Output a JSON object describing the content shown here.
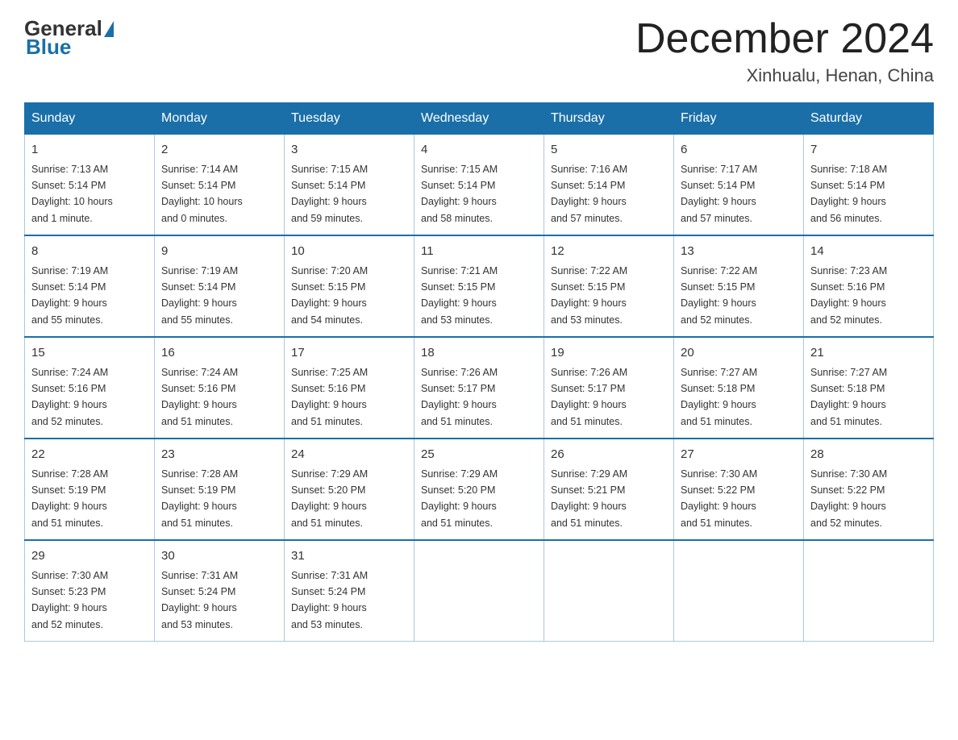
{
  "logo": {
    "general": "General",
    "blue": "Blue"
  },
  "title": "December 2024",
  "subtitle": "Xinhualu, Henan, China",
  "weekdays": [
    "Sunday",
    "Monday",
    "Tuesday",
    "Wednesday",
    "Thursday",
    "Friday",
    "Saturday"
  ],
  "weeks": [
    [
      {
        "day": "1",
        "sunrise": "7:13 AM",
        "sunset": "5:14 PM",
        "daylight": "10 hours and 1 minute."
      },
      {
        "day": "2",
        "sunrise": "7:14 AM",
        "sunset": "5:14 PM",
        "daylight": "10 hours and 0 minutes."
      },
      {
        "day": "3",
        "sunrise": "7:15 AM",
        "sunset": "5:14 PM",
        "daylight": "9 hours and 59 minutes."
      },
      {
        "day": "4",
        "sunrise": "7:15 AM",
        "sunset": "5:14 PM",
        "daylight": "9 hours and 58 minutes."
      },
      {
        "day": "5",
        "sunrise": "7:16 AM",
        "sunset": "5:14 PM",
        "daylight": "9 hours and 57 minutes."
      },
      {
        "day": "6",
        "sunrise": "7:17 AM",
        "sunset": "5:14 PM",
        "daylight": "9 hours and 57 minutes."
      },
      {
        "day": "7",
        "sunrise": "7:18 AM",
        "sunset": "5:14 PM",
        "daylight": "9 hours and 56 minutes."
      }
    ],
    [
      {
        "day": "8",
        "sunrise": "7:19 AM",
        "sunset": "5:14 PM",
        "daylight": "9 hours and 55 minutes."
      },
      {
        "day": "9",
        "sunrise": "7:19 AM",
        "sunset": "5:14 PM",
        "daylight": "9 hours and 55 minutes."
      },
      {
        "day": "10",
        "sunrise": "7:20 AM",
        "sunset": "5:15 PM",
        "daylight": "9 hours and 54 minutes."
      },
      {
        "day": "11",
        "sunrise": "7:21 AM",
        "sunset": "5:15 PM",
        "daylight": "9 hours and 53 minutes."
      },
      {
        "day": "12",
        "sunrise": "7:22 AM",
        "sunset": "5:15 PM",
        "daylight": "9 hours and 53 minutes."
      },
      {
        "day": "13",
        "sunrise": "7:22 AM",
        "sunset": "5:15 PM",
        "daylight": "9 hours and 52 minutes."
      },
      {
        "day": "14",
        "sunrise": "7:23 AM",
        "sunset": "5:16 PM",
        "daylight": "9 hours and 52 minutes."
      }
    ],
    [
      {
        "day": "15",
        "sunrise": "7:24 AM",
        "sunset": "5:16 PM",
        "daylight": "9 hours and 52 minutes."
      },
      {
        "day": "16",
        "sunrise": "7:24 AM",
        "sunset": "5:16 PM",
        "daylight": "9 hours and 51 minutes."
      },
      {
        "day": "17",
        "sunrise": "7:25 AM",
        "sunset": "5:16 PM",
        "daylight": "9 hours and 51 minutes."
      },
      {
        "day": "18",
        "sunrise": "7:26 AM",
        "sunset": "5:17 PM",
        "daylight": "9 hours and 51 minutes."
      },
      {
        "day": "19",
        "sunrise": "7:26 AM",
        "sunset": "5:17 PM",
        "daylight": "9 hours and 51 minutes."
      },
      {
        "day": "20",
        "sunrise": "7:27 AM",
        "sunset": "5:18 PM",
        "daylight": "9 hours and 51 minutes."
      },
      {
        "day": "21",
        "sunrise": "7:27 AM",
        "sunset": "5:18 PM",
        "daylight": "9 hours and 51 minutes."
      }
    ],
    [
      {
        "day": "22",
        "sunrise": "7:28 AM",
        "sunset": "5:19 PM",
        "daylight": "9 hours and 51 minutes."
      },
      {
        "day": "23",
        "sunrise": "7:28 AM",
        "sunset": "5:19 PM",
        "daylight": "9 hours and 51 minutes."
      },
      {
        "day": "24",
        "sunrise": "7:29 AM",
        "sunset": "5:20 PM",
        "daylight": "9 hours and 51 minutes."
      },
      {
        "day": "25",
        "sunrise": "7:29 AM",
        "sunset": "5:20 PM",
        "daylight": "9 hours and 51 minutes."
      },
      {
        "day": "26",
        "sunrise": "7:29 AM",
        "sunset": "5:21 PM",
        "daylight": "9 hours and 51 minutes."
      },
      {
        "day": "27",
        "sunrise": "7:30 AM",
        "sunset": "5:22 PM",
        "daylight": "9 hours and 51 minutes."
      },
      {
        "day": "28",
        "sunrise": "7:30 AM",
        "sunset": "5:22 PM",
        "daylight": "9 hours and 52 minutes."
      }
    ],
    [
      {
        "day": "29",
        "sunrise": "7:30 AM",
        "sunset": "5:23 PM",
        "daylight": "9 hours and 52 minutes."
      },
      {
        "day": "30",
        "sunrise": "7:31 AM",
        "sunset": "5:24 PM",
        "daylight": "9 hours and 53 minutes."
      },
      {
        "day": "31",
        "sunrise": "7:31 AM",
        "sunset": "5:24 PM",
        "daylight": "9 hours and 53 minutes."
      },
      null,
      null,
      null,
      null
    ]
  ],
  "labels": {
    "sunrise": "Sunrise:",
    "sunset": "Sunset:",
    "daylight": "Daylight:"
  }
}
